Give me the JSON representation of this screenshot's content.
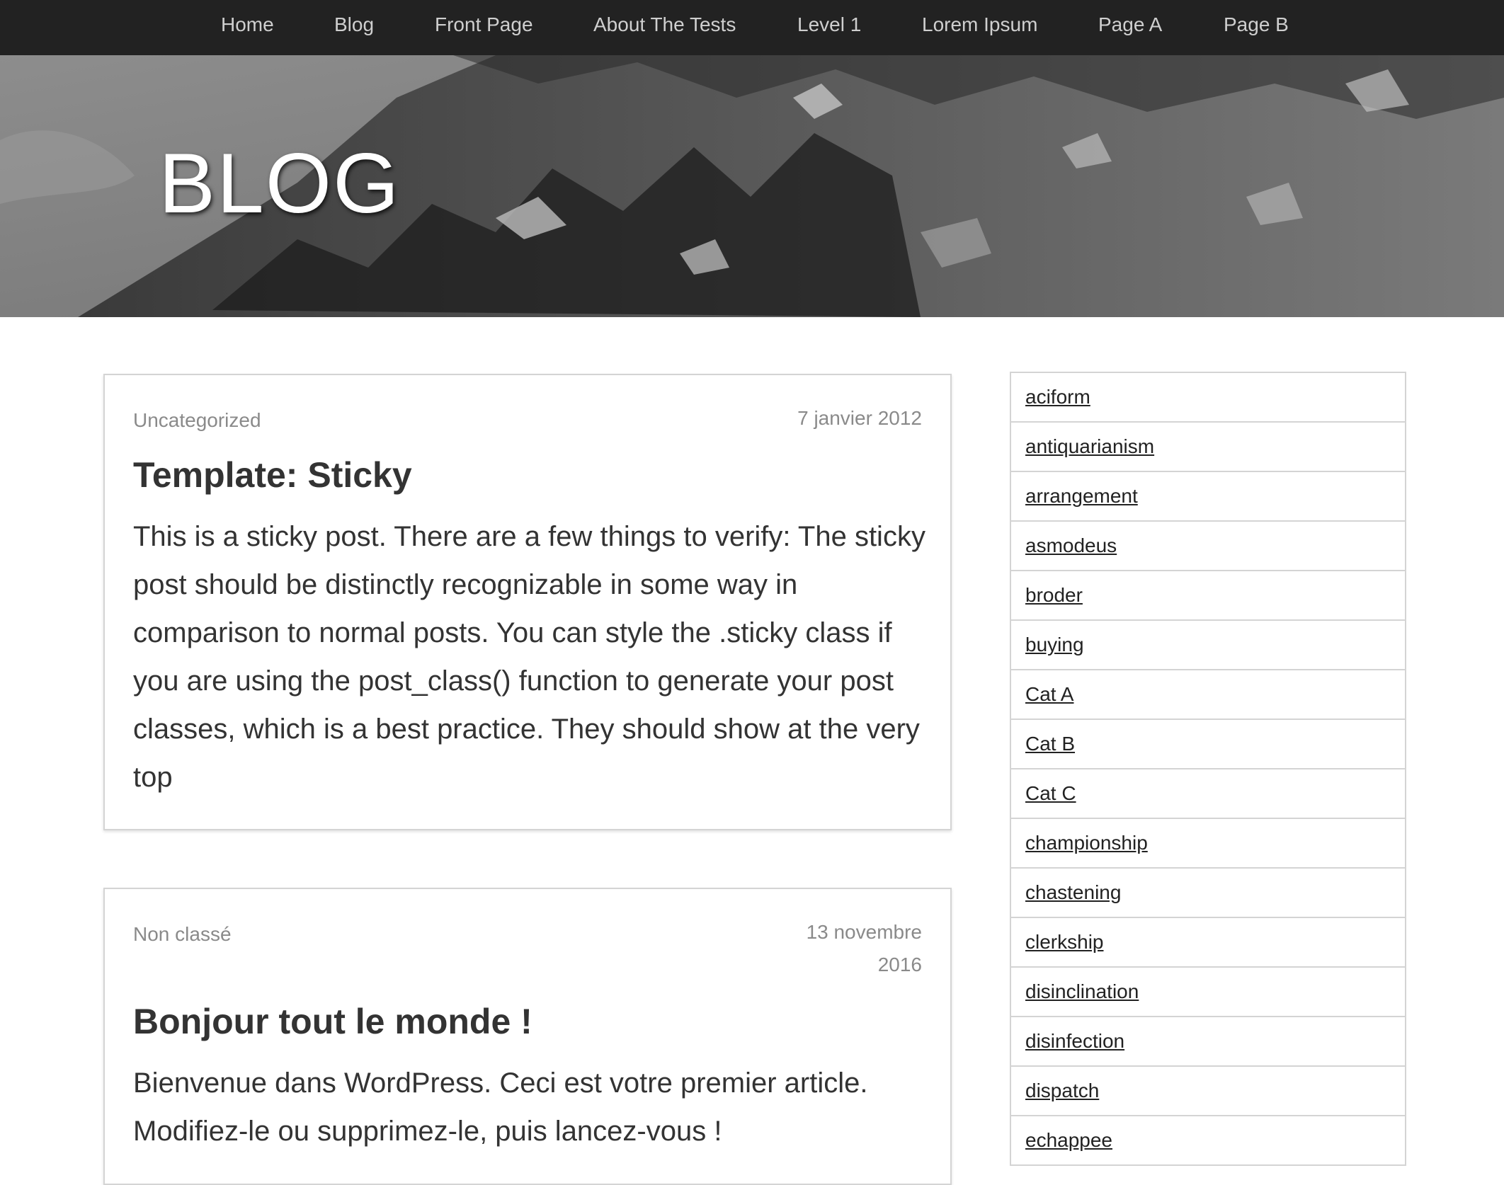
{
  "nav": {
    "items": [
      "Home",
      "Blog",
      "Front Page",
      "About The Tests",
      "Level 1",
      "Lorem Ipsum",
      "Page A",
      "Page B"
    ]
  },
  "hero": {
    "title": "BLOG"
  },
  "posts": [
    {
      "category": "Uncategorized",
      "date": "7 janvier 2012",
      "title": "Template: Sticky",
      "excerpt": "This is a sticky post. There are a few things to verify: The sticky post should be distinctly recognizable in some way in comparison to normal posts. You can style the .sticky class if you are using the post_class() function to generate your post classes, which is a best practice. They should show at the very top"
    },
    {
      "category": "Non classé",
      "date": "13 novembre 2016",
      "title": "Bonjour tout le monde !",
      "excerpt": "Bienvenue dans WordPress. Ceci est votre premier article. Modifiez-le ou supprimez-le, puis lancez-vous !"
    }
  ],
  "sidebar": {
    "tags": [
      "aciform",
      "antiquarianism",
      "arrangement",
      "asmodeus",
      "broder",
      "buying",
      "Cat A",
      "Cat B",
      "Cat C",
      "championship",
      "chastening",
      "clerkship",
      "disinclination",
      "disinfection",
      "dispatch",
      "echappee"
    ]
  }
}
